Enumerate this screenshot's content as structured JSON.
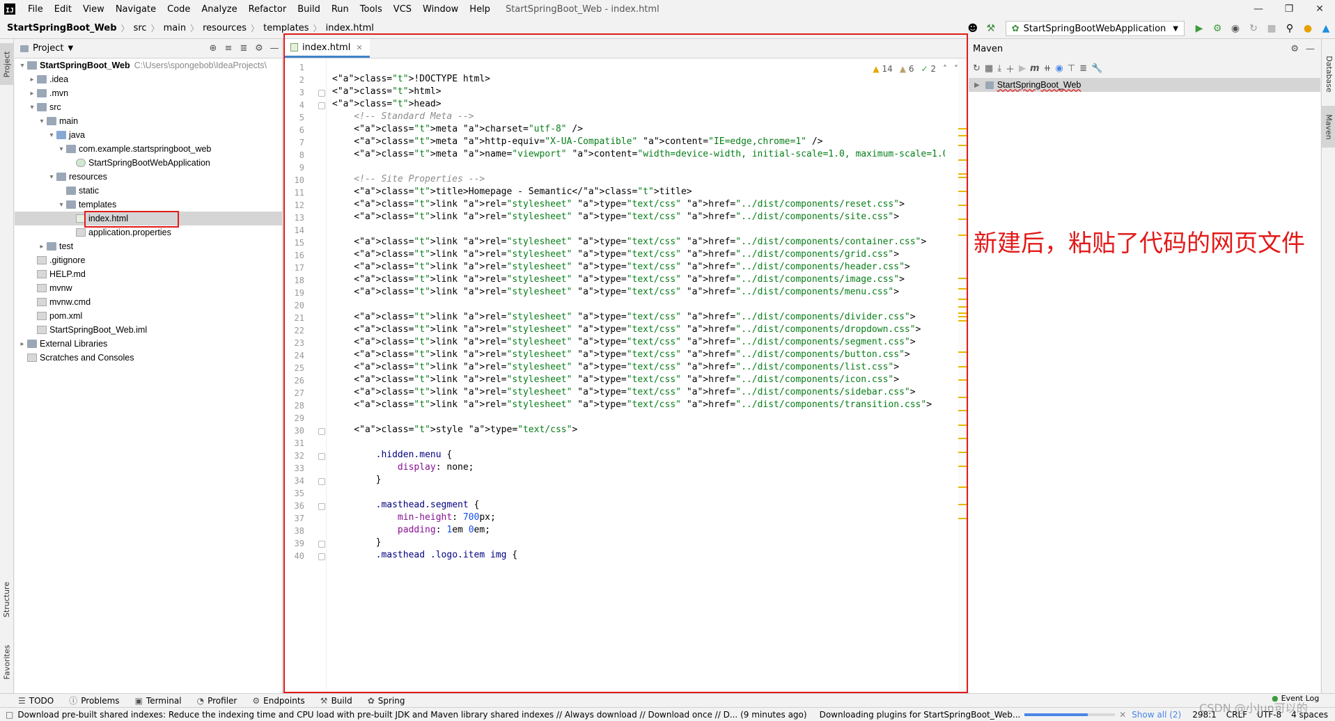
{
  "menu": {
    "items": [
      "File",
      "Edit",
      "View",
      "Navigate",
      "Code",
      "Analyze",
      "Refactor",
      "Build",
      "Run",
      "Tools",
      "VCS",
      "Window",
      "Help"
    ],
    "title": "StartSpringBoot_Web - index.html"
  },
  "breadcrumb": [
    "StartSpringBoot_Web",
    "src",
    "main",
    "resources",
    "templates",
    "index.html"
  ],
  "run_config": "StartSpringBootWebApplication",
  "project": {
    "header": "Project",
    "path_hint": "C:\\Users\\spongebob\\IdeaProjects\\",
    "tree": [
      {
        "label": "StartSpringBoot_Web",
        "depth": 0,
        "arrow": "v",
        "icon": "folder",
        "bold": true
      },
      {
        "label": ".idea",
        "depth": 1,
        "arrow": ">",
        "icon": "folder"
      },
      {
        "label": ".mvn",
        "depth": 1,
        "arrow": ">",
        "icon": "folder"
      },
      {
        "label": "src",
        "depth": 1,
        "arrow": "v",
        "icon": "folder"
      },
      {
        "label": "main",
        "depth": 2,
        "arrow": "v",
        "icon": "folder"
      },
      {
        "label": "java",
        "depth": 3,
        "arrow": "v",
        "icon": "folder-blue"
      },
      {
        "label": "com.example.startspringboot_web",
        "depth": 4,
        "arrow": "v",
        "icon": "folder"
      },
      {
        "label": "StartSpringBootWebApplication",
        "depth": 5,
        "arrow": "",
        "icon": "class"
      },
      {
        "label": "resources",
        "depth": 3,
        "arrow": "v",
        "icon": "folder"
      },
      {
        "label": "static",
        "depth": 4,
        "arrow": "",
        "icon": "folder"
      },
      {
        "label": "templates",
        "depth": 4,
        "arrow": "v",
        "icon": "folder"
      },
      {
        "label": "index.html",
        "depth": 5,
        "arrow": "",
        "icon": "html",
        "selected": true
      },
      {
        "label": "application.properties",
        "depth": 5,
        "arrow": "",
        "icon": "file"
      },
      {
        "label": "test",
        "depth": 2,
        "arrow": ">",
        "icon": "folder"
      },
      {
        "label": ".gitignore",
        "depth": 1,
        "arrow": "",
        "icon": "file"
      },
      {
        "label": "HELP.md",
        "depth": 1,
        "arrow": "",
        "icon": "file"
      },
      {
        "label": "mvnw",
        "depth": 1,
        "arrow": "",
        "icon": "file"
      },
      {
        "label": "mvnw.cmd",
        "depth": 1,
        "arrow": "",
        "icon": "file"
      },
      {
        "label": "pom.xml",
        "depth": 1,
        "arrow": "",
        "icon": "file"
      },
      {
        "label": "StartSpringBoot_Web.iml",
        "depth": 1,
        "arrow": "",
        "icon": "file"
      },
      {
        "label": "External Libraries",
        "depth": 0,
        "arrow": ">",
        "icon": "folder"
      },
      {
        "label": "Scratches and Consoles",
        "depth": 0,
        "arrow": "",
        "icon": "file"
      }
    ]
  },
  "editor": {
    "tab": "index.html",
    "inspections": {
      "warnings": "14",
      "weak": "6",
      "ok": "2"
    },
    "lines": [
      "",
      "<!DOCTYPE html>",
      "<html>",
      "<head>",
      "    <!-- Standard Meta -->",
      "    <meta charset=\"utf-8\" />",
      "    <meta http-equiv=\"X-UA-Compatible\" content=\"IE=edge,chrome=1\" />",
      "    <meta name=\"viewport\" content=\"width=device-width, initial-scale=1.0, maximum-scale=1.0\">",
      "",
      "    <!-- Site Properties -->",
      "    <title>Homepage - Semantic</title>",
      "    <link rel=\"stylesheet\" type=\"text/css\" href=\"../dist/components/reset.css\">",
      "    <link rel=\"stylesheet\" type=\"text/css\" href=\"../dist/components/site.css\">",
      "",
      "    <link rel=\"stylesheet\" type=\"text/css\" href=\"../dist/components/container.css\">",
      "    <link rel=\"stylesheet\" type=\"text/css\" href=\"../dist/components/grid.css\">",
      "    <link rel=\"stylesheet\" type=\"text/css\" href=\"../dist/components/header.css\">",
      "    <link rel=\"stylesheet\" type=\"text/css\" href=\"../dist/components/image.css\">",
      "    <link rel=\"stylesheet\" type=\"text/css\" href=\"../dist/components/menu.css\">",
      "",
      "    <link rel=\"stylesheet\" type=\"text/css\" href=\"../dist/components/divider.css\">",
      "    <link rel=\"stylesheet\" type=\"text/css\" href=\"../dist/components/dropdown.css\">",
      "    <link rel=\"stylesheet\" type=\"text/css\" href=\"../dist/components/segment.css\">",
      "    <link rel=\"stylesheet\" type=\"text/css\" href=\"../dist/components/button.css\">",
      "    <link rel=\"stylesheet\" type=\"text/css\" href=\"../dist/components/list.css\">",
      "    <link rel=\"stylesheet\" type=\"text/css\" href=\"../dist/components/icon.css\">",
      "    <link rel=\"stylesheet\" type=\"text/css\" href=\"../dist/components/sidebar.css\">",
      "    <link rel=\"stylesheet\" type=\"text/css\" href=\"../dist/components/transition.css\">",
      "",
      "    <style type=\"text/css\">",
      "",
      "        .hidden.menu {",
      "            display: none;",
      "        }",
      "",
      "        .masthead.segment {",
      "            min-height: 700px;",
      "            padding: 1em 0em;",
      "        }",
      "        .masthead .logo.item img {"
    ]
  },
  "maven": {
    "header": "Maven",
    "project": "StartSpringBoot_Web"
  },
  "annotation": "新建后，粘贴了代码的网页文件",
  "left_tabs": [
    "Project",
    "Structure",
    "Favorites"
  ],
  "right_tabs": [
    "Database",
    "Maven"
  ],
  "bottom_tabs": [
    "TODO",
    "Problems",
    "Terminal",
    "Profiler",
    "Endpoints",
    "Build",
    "Spring"
  ],
  "event_log": "Event Log",
  "status": {
    "message": "Download pre-built shared indexes: Reduce the indexing time and CPU load with pre-built JDK and Maven library shared indexes // Always download // Download once // D... (9 minutes ago)",
    "task": "Downloading plugins for StartSpringBoot_Web...",
    "show_all": "Show all (2)",
    "position": "298:1",
    "line_sep": "CRLF",
    "encoding": "UTF-8",
    "indent": "4 spaces",
    "watermark": "CSDN @小Jun可以的"
  }
}
